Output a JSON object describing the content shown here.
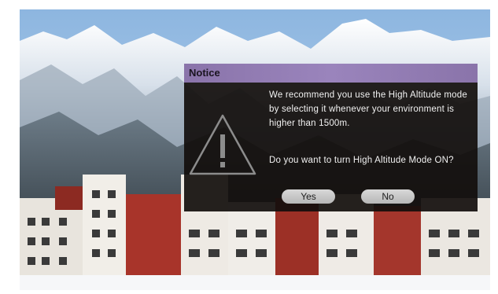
{
  "dialog": {
    "title": "Notice",
    "icon": "warning-triangle-icon",
    "message": "We recommend you use the High Altitude mode by selecting it whenever your environment is higher than 1500m.",
    "question": "Do you want to turn High Altitude Mode ON?",
    "yes_label": "Yes",
    "no_label": "No"
  },
  "colors": {
    "title_bar": "#9a84bc",
    "dialog_bg": "#120e0c",
    "button": "#c8c8c8"
  }
}
